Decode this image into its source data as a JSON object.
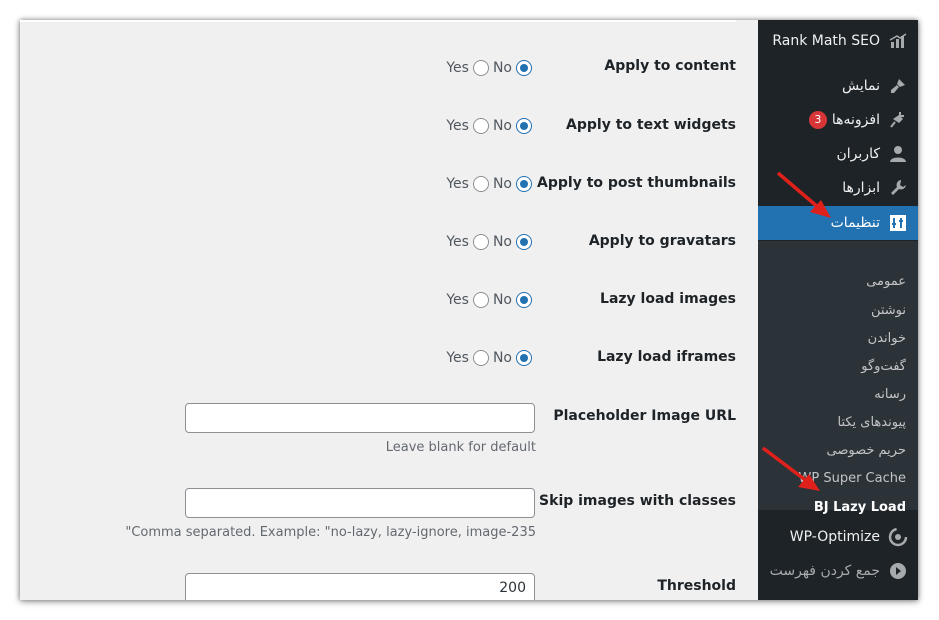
{
  "sidebar": {
    "items": [
      {
        "label": "Rank Math SEO",
        "icon": "rank-math-icon"
      },
      {
        "label": "نمایش",
        "icon": "paintbrush-icon"
      },
      {
        "label": "افزونه‌ها",
        "icon": "plugin-icon",
        "badge": "3"
      },
      {
        "label": "کاربران",
        "icon": "user-icon"
      },
      {
        "label": "ابزارها",
        "icon": "wrench-icon"
      },
      {
        "label": "تنظیمات",
        "icon": "settings-icon",
        "active": true
      },
      {
        "label": "WP-Optimize",
        "icon": "wp-optimize-icon"
      },
      {
        "label": "جمع کردن فهرست",
        "icon": "collapse-icon"
      }
    ],
    "submenu": [
      "عمومی",
      "نوشتن",
      "خواندن",
      "گفت‌وگو",
      "رسانه",
      "پیوندهای یکتا",
      "حریم خصوصی",
      "WP Super Cache",
      "BJ Lazy Load"
    ],
    "current_submenu": "BJ Lazy Load"
  },
  "settings": {
    "radio_rows": [
      {
        "label": "Apply to content",
        "yes": "Yes",
        "no": "No",
        "selected": "No"
      },
      {
        "label": "Apply to text widgets",
        "yes": "Yes",
        "no": "No",
        "selected": "No"
      },
      {
        "label": "Apply to post thumbnails",
        "yes": "Yes",
        "no": "No",
        "selected": "No"
      },
      {
        "label": "Apply to gravatars",
        "yes": "Yes",
        "no": "No",
        "selected": "No"
      },
      {
        "label": "Lazy load images",
        "yes": "Yes",
        "no": "No",
        "selected": "No"
      },
      {
        "label": "Lazy load iframes",
        "yes": "Yes",
        "no": "No",
        "selected": "No"
      }
    ],
    "placeholder_image": {
      "label": "Placeholder Image URL",
      "value": "",
      "description": "Leave blank for default"
    },
    "skip_classes": {
      "label": "Skip images with classes",
      "value": "",
      "description": "\"Comma separated. Example: \"no-lazy, lazy-ignore, image-235"
    },
    "threshold": {
      "label": "Threshold",
      "value": "200"
    }
  },
  "colors": {
    "sidebar_bg": "#1d2327",
    "submenu_bg": "#2c3338",
    "active_blue": "#2271b1",
    "arrow_red": "#e0201b",
    "content_bg": "#f0f0f1"
  }
}
